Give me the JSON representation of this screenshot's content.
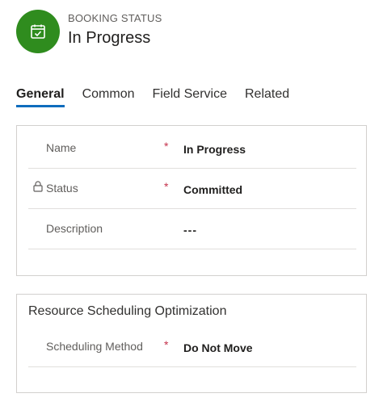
{
  "header": {
    "entity_type": "BOOKING STATUS",
    "record_title": "In Progress",
    "avatar_icon": "calendar-icon",
    "avatar_color": "#2f8c1e"
  },
  "tabs": [
    {
      "label": "General",
      "active": true
    },
    {
      "label": "Common",
      "active": false
    },
    {
      "label": "Field Service",
      "active": false
    },
    {
      "label": "Related",
      "active": false
    }
  ],
  "general": {
    "fields": [
      {
        "label": "Name",
        "required": "*",
        "value": "In Progress",
        "locked": false
      },
      {
        "label": "Status",
        "required": "*",
        "value": "Committed",
        "locked": true
      },
      {
        "label": "Description",
        "required": "",
        "value": "---",
        "locked": false
      }
    ]
  },
  "rso": {
    "title": "Resource Scheduling Optimization",
    "fields": [
      {
        "label": "Scheduling Method",
        "required": "*",
        "value": "Do Not Move"
      }
    ]
  },
  "colors": {
    "accent": "#0f6cbd",
    "required": "#c4314b"
  }
}
